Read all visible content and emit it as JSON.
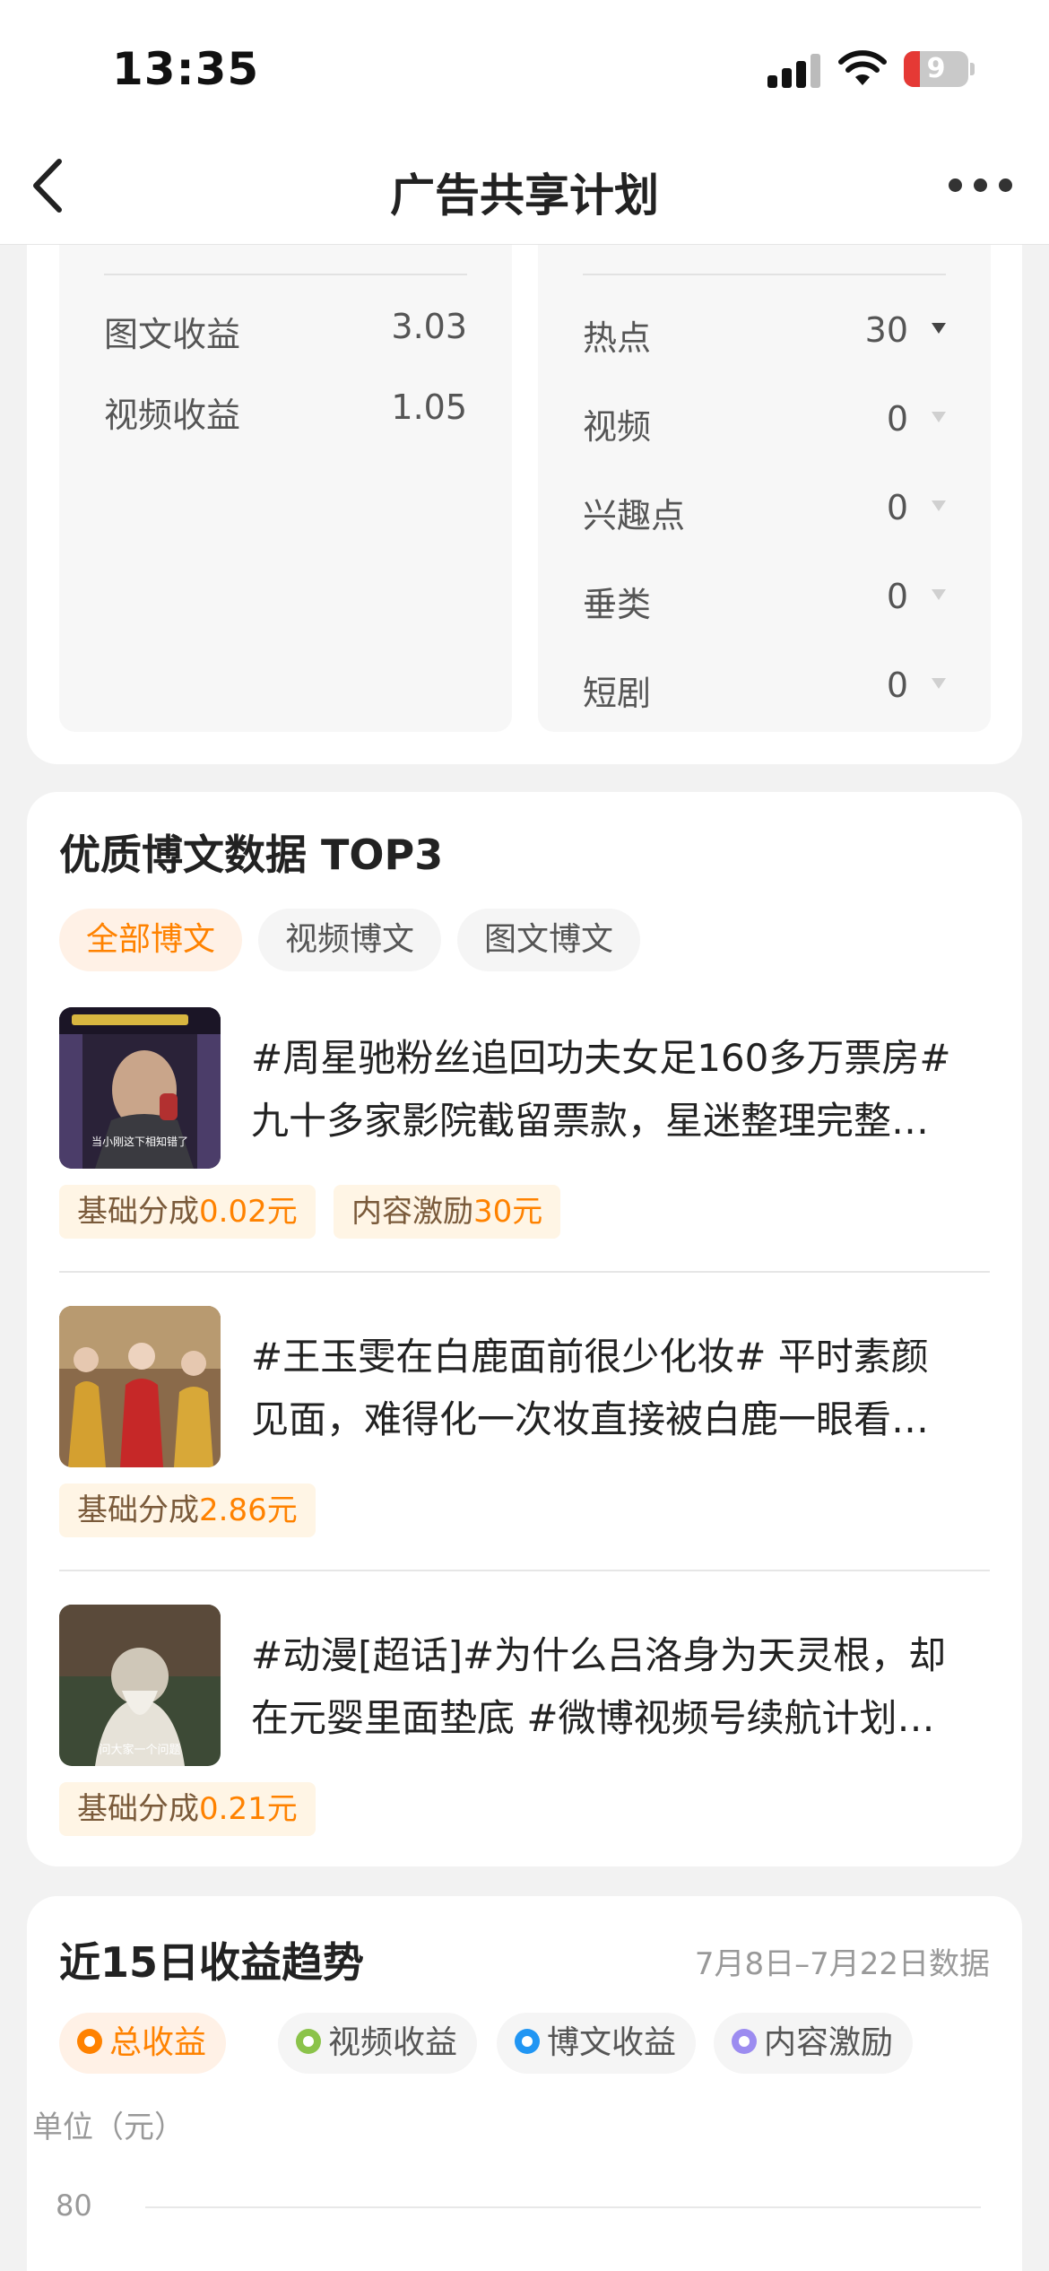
{
  "status_bar": {
    "time": "13:35",
    "battery": "9"
  },
  "nav": {
    "title": "广告共享计划"
  },
  "earnings_panel": {
    "rows": [
      {
        "label": "图文收益",
        "value": "3.03"
      },
      {
        "label": "视频收益",
        "value": "1.05"
      }
    ]
  },
  "category_panel": {
    "rows": [
      {
        "label": "热点",
        "value": "30"
      },
      {
        "label": "视频",
        "value": "0"
      },
      {
        "label": "兴趣点",
        "value": "0"
      },
      {
        "label": "垂类",
        "value": "0"
      },
      {
        "label": "短剧",
        "value": "0"
      }
    ]
  },
  "top_posts": {
    "title": "优质博文数据 TOP3",
    "tabs": [
      "全部博文",
      "视频博文",
      "图文博文"
    ],
    "posts": [
      {
        "line1": "#周星驰粉丝追回功夫女足160多万票房#",
        "line2": "九十多家影院截留票款，星迷整理完整…",
        "thumb_caption": "当小刚这下相知错了",
        "tags": [
          {
            "label": "基础分成",
            "amount": "0.02元"
          },
          {
            "label": "内容激励",
            "amount": "30元"
          }
        ]
      },
      {
        "line1": "#王玉雯在白鹿面前很少化妆# 平时素颜",
        "line2": "见面，难得化一次妆直接被白鹿一眼看…",
        "thumb_caption": "",
        "tags": [
          {
            "label": "基础分成",
            "amount": "2.86元"
          }
        ]
      },
      {
        "line1": "#动漫[超话]#为什么吕洛身为天灵根，却",
        "line2": "在元婴里面垫底 #微博视频号续航计划…",
        "thumb_caption": "问大家一个问题",
        "tags": [
          {
            "label": "基础分成",
            "amount": "0.21元"
          }
        ]
      }
    ]
  },
  "trend": {
    "title": "近15日收益趋势",
    "date_range": "7月8日–7月22日数据",
    "legend": [
      {
        "label": "总收益",
        "color": "#ff8200"
      },
      {
        "label": "视频收益",
        "color": "#8bc34a"
      },
      {
        "label": "博文收益",
        "color": "#2196f3"
      },
      {
        "label": "内容激励",
        "color": "#9c8cf0"
      }
    ],
    "unit": "单位（元）",
    "y_tick": "80"
  }
}
